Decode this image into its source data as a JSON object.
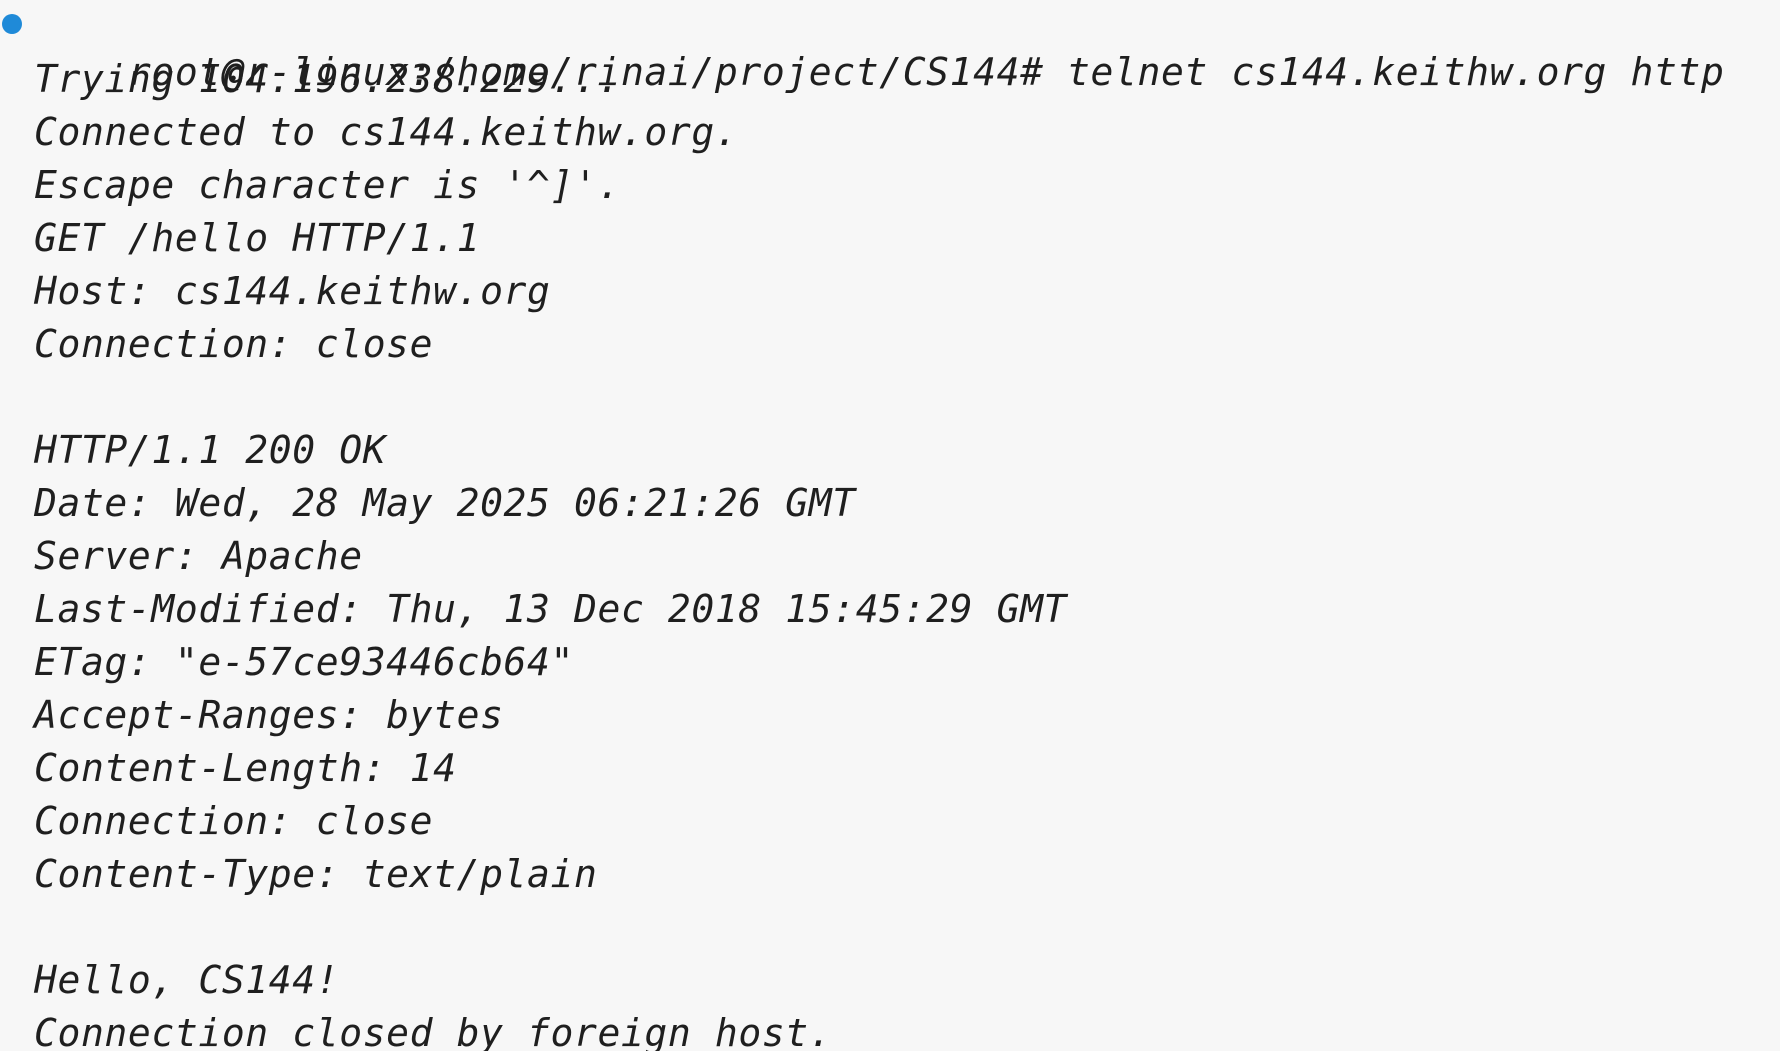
{
  "terminal": {
    "status_color": "#1f8ad8",
    "lines": {
      "cmd": "root@r-linux:/home/rinai/project/CS144# telnet cs144.keithw.org http",
      "l1": "Trying 104.196.238.229...",
      "l2": "Connected to cs144.keithw.org.",
      "l3": "Escape character is '^]'.",
      "l4": "GET /hello HTTP/1.1",
      "l5": "Host: cs144.keithw.org",
      "l6": "Connection: close",
      "l8": "HTTP/1.1 200 OK",
      "l9": "Date: Wed, 28 May 2025 06:21:26 GMT",
      "l10": "Server: Apache",
      "l11": "Last-Modified: Thu, 13 Dec 2018 15:45:29 GMT",
      "l12": "ETag: \"e-57ce93446cb64\"",
      "l13": "Accept-Ranges: bytes",
      "l14": "Content-Length: 14",
      "l15": "Connection: close",
      "l16": "Content-Type: text/plain",
      "l18": "Hello, CS144!",
      "l19": "Connection closed by foreign host."
    }
  }
}
